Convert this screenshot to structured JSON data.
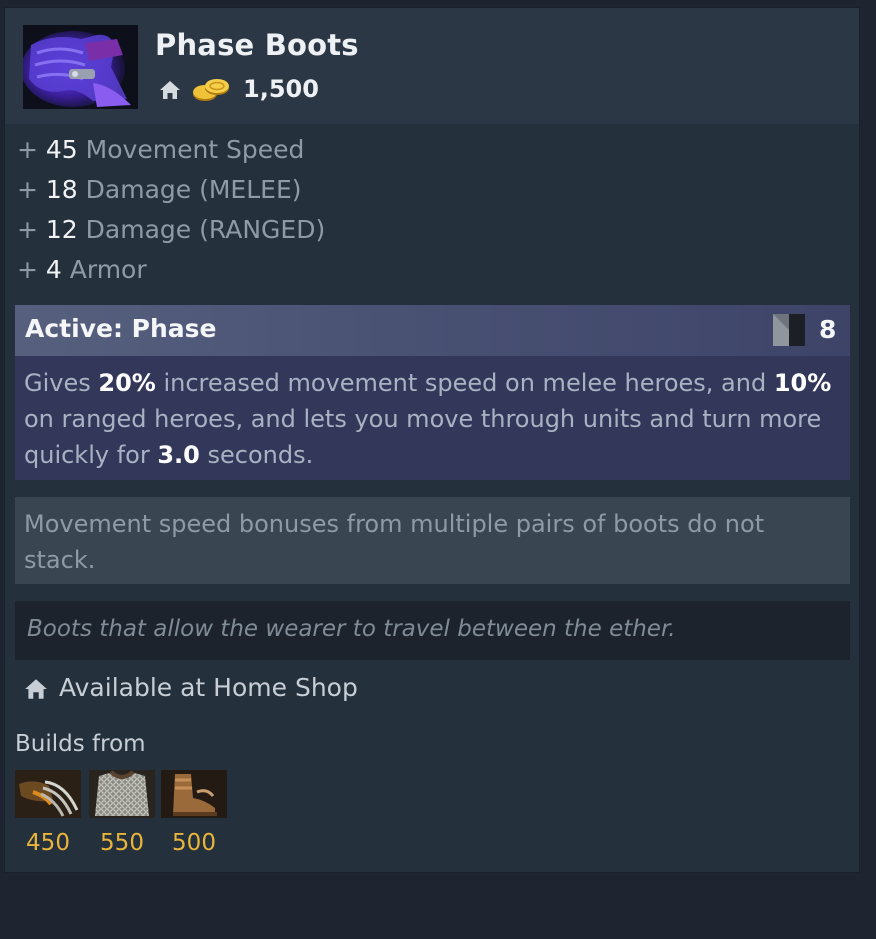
{
  "item": {
    "name": "Phase Boots",
    "icon": "phase-boots-image",
    "shop_icon": "home-icon",
    "gold_icon": "gold-coins-icon",
    "cost": "1,500"
  },
  "stats": [
    {
      "plus": "+",
      "value": "45",
      "label": "Movement Speed"
    },
    {
      "plus": "+",
      "value": "18",
      "label": "Damage (MELEE)"
    },
    {
      "plus": "+",
      "value": "12",
      "label": "Damage (RANGED)"
    },
    {
      "plus": "+",
      "value": "4",
      "label": "Armor"
    }
  ],
  "active": {
    "title": "Active: Phase",
    "cooldown_icon": "cooldown-icon",
    "cooldown": "8",
    "desc": {
      "p1": "Gives ",
      "b1": "20%",
      "p2": " increased movement speed on melee heroes, and ",
      "b2": "10%",
      "p3": " on ranged heroes, and lets you move through units and turn more quickly for ",
      "b3": "3.0",
      "p4": " seconds."
    }
  },
  "note": "Movement speed bonuses from multiple pairs of boots do not stack.",
  "lore": "Boots that allow the wearer to travel between the ether.",
  "availability": {
    "icon": "home-icon",
    "text": "Available at Home Shop"
  },
  "builds_from": {
    "label": "Builds from",
    "components": [
      {
        "icon": "blades-of-attack-image",
        "price": "450"
      },
      {
        "icon": "chainmail-image",
        "price": "550"
      },
      {
        "icon": "boots-of-speed-image",
        "price": "500"
      }
    ]
  },
  "colors": {
    "panel": "#25303d",
    "header": "#2c3745",
    "active_body": "#33385a",
    "note_bg": "#3a4552",
    "lore_bg": "#1c232d",
    "gold": "#e8b53a"
  }
}
